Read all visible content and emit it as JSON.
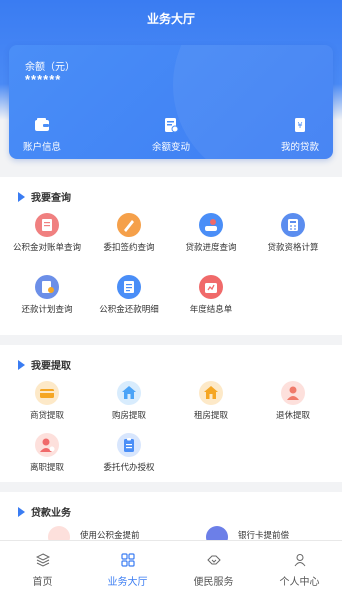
{
  "header": {
    "title": "业务大厅"
  },
  "balance": {
    "label": "余额（元）",
    "value": "******",
    "actions": [
      {
        "label": "账户信息",
        "icon": "wallet-icon"
      },
      {
        "label": "余额变动",
        "icon": "document-chart-icon"
      },
      {
        "label": "我的贷款",
        "icon": "loan-document-icon"
      }
    ]
  },
  "query": {
    "title": "我要查询",
    "items": [
      {
        "label": "公积金对账单查询",
        "icon": "statement-icon",
        "color": "#f08080"
      },
      {
        "label": "委扣签约查询",
        "icon": "pen-icon",
        "color": "#f5a04a"
      },
      {
        "label": "贷款进度查询",
        "icon": "progress-icon",
        "color": "#4a8ef7"
      },
      {
        "label": "贷款资格计算",
        "icon": "calculator-icon",
        "color": "#5b8def"
      },
      {
        "label": "还款计划查询",
        "icon": "plan-icon",
        "color": "#6c8fe8"
      },
      {
        "label": "公积金还款明细",
        "icon": "repayment-detail-icon",
        "color": "#4a8ef7"
      },
      {
        "label": "年度结息单",
        "icon": "annual-interest-icon",
        "color": "#f06a6a"
      }
    ]
  },
  "withdraw": {
    "title": "我要提取",
    "items": [
      {
        "label": "商贷提取",
        "icon": "card-icon",
        "color": "#f5a623"
      },
      {
        "label": "购房提取",
        "icon": "house-icon",
        "color": "#4aa3f7"
      },
      {
        "label": "租房提取",
        "icon": "rent-house-icon",
        "color": "#f5a623"
      },
      {
        "label": "退休提取",
        "icon": "retire-icon",
        "color": "#f07a6a"
      },
      {
        "label": "离职提取",
        "icon": "resign-icon",
        "color": "#f06a6a"
      },
      {
        "label": "委托代办授权",
        "icon": "clipboard-icon",
        "color": "#4a8ef7"
      }
    ]
  },
  "loan": {
    "title": "贷款业务",
    "items": [
      {
        "label": "使用公积金提前",
        "icon": "early-repay-icon",
        "color": "#f06a6a"
      },
      {
        "label": "银行卡提前偿",
        "icon": "bank-card-icon",
        "color": "#6c7fe8"
      }
    ]
  },
  "nav": [
    {
      "label": "首页",
      "icon": "layers-icon"
    },
    {
      "label": "业务大厅",
      "icon": "grid-icon",
      "active": true
    },
    {
      "label": "便民服务",
      "icon": "handshake-icon"
    },
    {
      "label": "个人中心",
      "icon": "person-icon"
    }
  ],
  "colors": {
    "primary": "#3a7cf2",
    "background": "#f2f3f5"
  }
}
